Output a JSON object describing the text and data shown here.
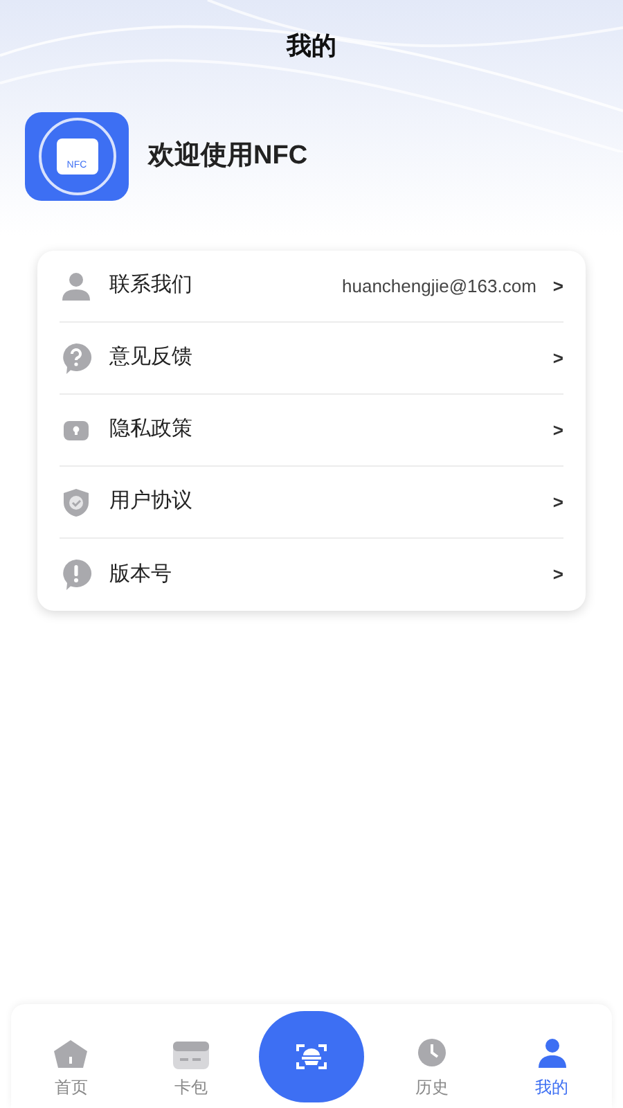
{
  "header": {
    "title": "我的"
  },
  "profile": {
    "welcome": "欢迎使用NFC",
    "logo_text": "NFC"
  },
  "menu": [
    {
      "kind": "contact",
      "label": "联系我们",
      "value": "huanchengjie@163.com",
      "chevron": ">"
    },
    {
      "kind": "feedback",
      "label": "意见反馈",
      "chevron": ">"
    },
    {
      "kind": "privacy",
      "label": "隐私政策",
      "chevron": ">"
    },
    {
      "kind": "agreement",
      "label": "用户协议",
      "chevron": ">"
    },
    {
      "kind": "version",
      "label": "版本号",
      "chevron": ">"
    }
  ],
  "tab_bar": [
    {
      "kind": "home",
      "label": "首页",
      "selected": false
    },
    {
      "kind": "wallet",
      "label": "卡包",
      "selected": false
    },
    {
      "kind": "scan",
      "selected": false
    },
    {
      "kind": "history",
      "label": "历史",
      "selected": false
    },
    {
      "kind": "mine",
      "label": "我的",
      "selected": true
    }
  ]
}
